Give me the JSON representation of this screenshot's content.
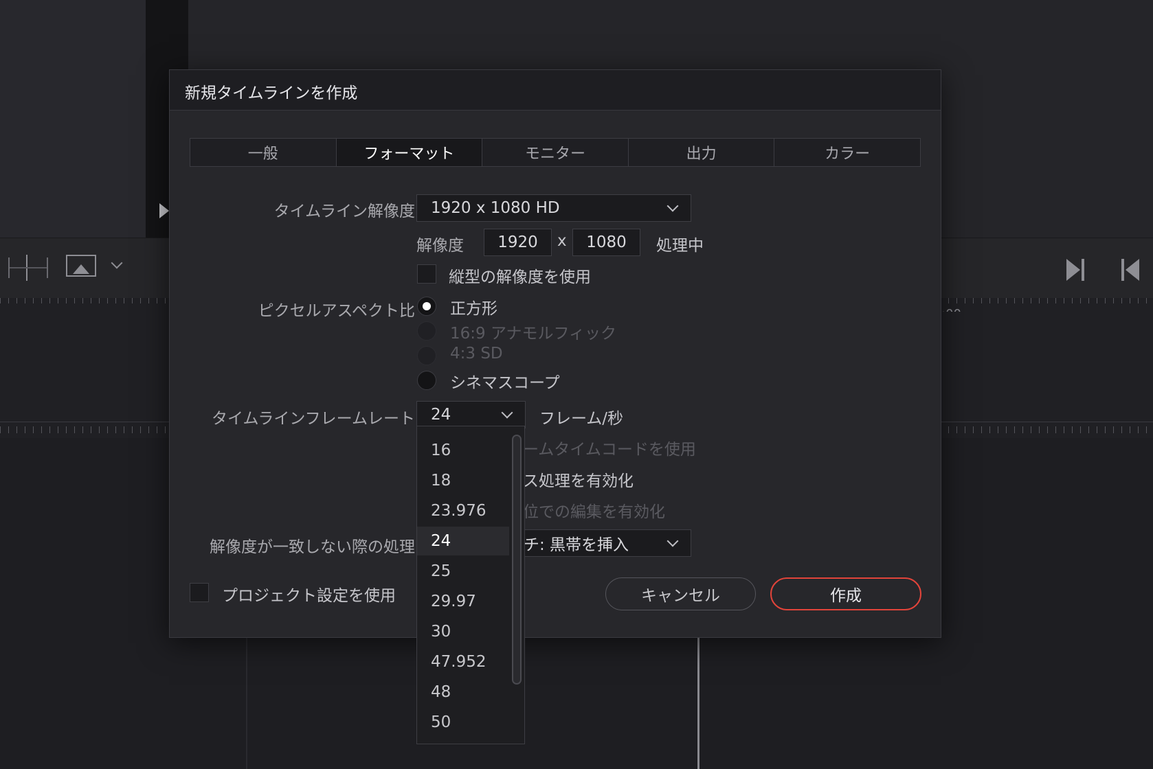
{
  "dialog": {
    "title": "新規タイムラインを作成"
  },
  "tabs": [
    "一般",
    "フォーマット",
    "モニター",
    "出力",
    "カラー"
  ],
  "active_tab": "フォーマット",
  "resolution": {
    "label": "タイムライン解像度",
    "value": "1920 x 1080 HD",
    "sub_label": "解像度",
    "width": "1920",
    "x": "x",
    "height": "1080",
    "processing": "処理中"
  },
  "vertical": {
    "label": "縦型の解像度を使用",
    "checked": false
  },
  "pixel_aspect": {
    "label": "ピクセルアスペクト比",
    "options": [
      {
        "label": "正方形",
        "selected": true,
        "enabled": true
      },
      {
        "label": "16:9 アナモルフィック",
        "selected": false,
        "enabled": false
      },
      {
        "label": "4:3 SD",
        "selected": false,
        "enabled": false
      },
      {
        "label": "シネマスコープ",
        "selected": false,
        "enabled": true
      }
    ]
  },
  "frame_rate": {
    "label": "タイムラインフレームレート",
    "value": "24",
    "unit": "フレーム/秒",
    "options": [
      "16",
      "18",
      "23.976",
      "24",
      "25",
      "29.97",
      "30",
      "47.952",
      "48",
      "50"
    ]
  },
  "partial": {
    "drop_frame": "ームタイムコードを使用",
    "interlace": "ス処理を有効化",
    "field_edit": "位での編集を有効化",
    "mismatch_value": "チ: 黒帯を挿入"
  },
  "mismatch": {
    "label": "解像度が一致しない際の処理"
  },
  "project_settings": {
    "label": "プロジェクト設定を使用",
    "checked": false
  },
  "buttons": {
    "cancel": "キャンセル",
    "create": "作成"
  },
  "background": {
    "timecode": ":00"
  },
  "colors": {
    "accent": "#e2443a",
    "dialog_bg": "#27272b",
    "app_bg": "#1f1f23"
  }
}
